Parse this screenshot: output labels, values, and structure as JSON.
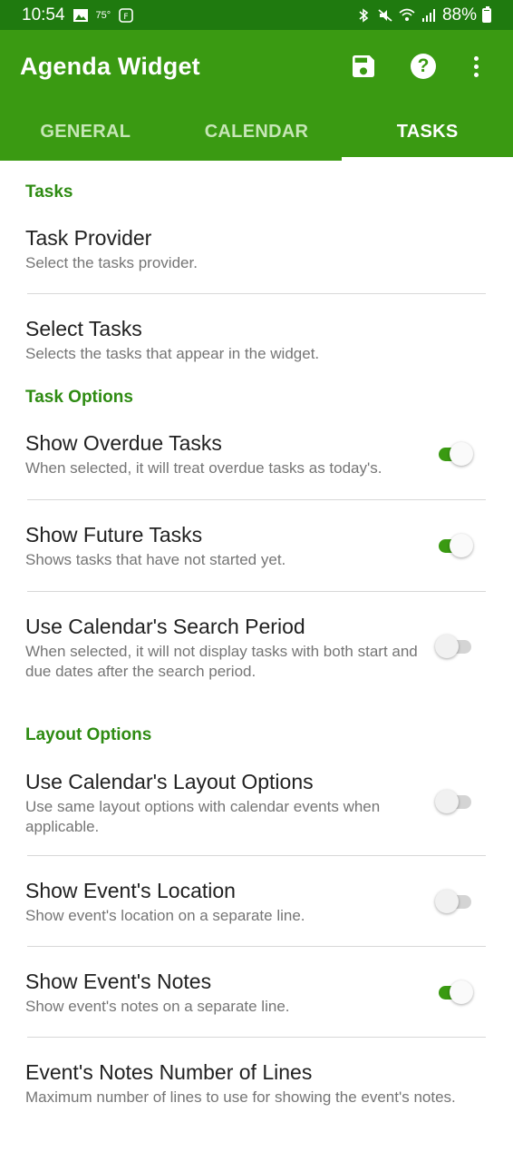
{
  "status_bar": {
    "time": "10:54",
    "temperature": "75°",
    "battery": "88%"
  },
  "app_bar": {
    "title": "Agenda Widget"
  },
  "tabs": [
    {
      "label": "GENERAL",
      "active": false
    },
    {
      "label": "CALENDAR",
      "active": false
    },
    {
      "label": "TASKS",
      "active": true
    }
  ],
  "sections": {
    "tasks": {
      "title": "Tasks",
      "items": [
        {
          "title": "Task Provider",
          "summary": "Select the tasks provider."
        },
        {
          "title": "Select Tasks",
          "summary": "Selects the tasks that appear in the widget."
        }
      ]
    },
    "task_options": {
      "title": "Task Options",
      "items": [
        {
          "title": "Show Overdue Tasks",
          "summary": "When selected, it will treat overdue tasks as today's.",
          "checked": true
        },
        {
          "title": "Show Future Tasks",
          "summary": "Shows tasks that have not started yet.",
          "checked": true
        },
        {
          "title": "Use Calendar's Search Period",
          "summary": "When selected, it will not display tasks with both start and due dates after the search period.",
          "checked": false
        }
      ]
    },
    "layout_options": {
      "title": "Layout Options",
      "items": [
        {
          "title": "Use Calendar's Layout Options",
          "summary": "Use same layout options with calendar events when applicable.",
          "checked": false
        },
        {
          "title": "Show Event's Location",
          "summary": "Show event's location on a separate line.",
          "checked": false
        },
        {
          "title": "Show Event's Notes",
          "summary": "Show event's notes on a separate line.",
          "checked": true
        },
        {
          "title": "Event's Notes Number of Lines",
          "summary": "Maximum number of lines to use for showing the event's notes."
        }
      ]
    }
  },
  "colors": {
    "status_bar": "#1f7a0f",
    "primary": "#3a9a12",
    "section_title": "#2e8b12"
  },
  "icons": {
    "save": "save-icon",
    "help": "help-icon",
    "overflow": "more-vert-icon"
  }
}
